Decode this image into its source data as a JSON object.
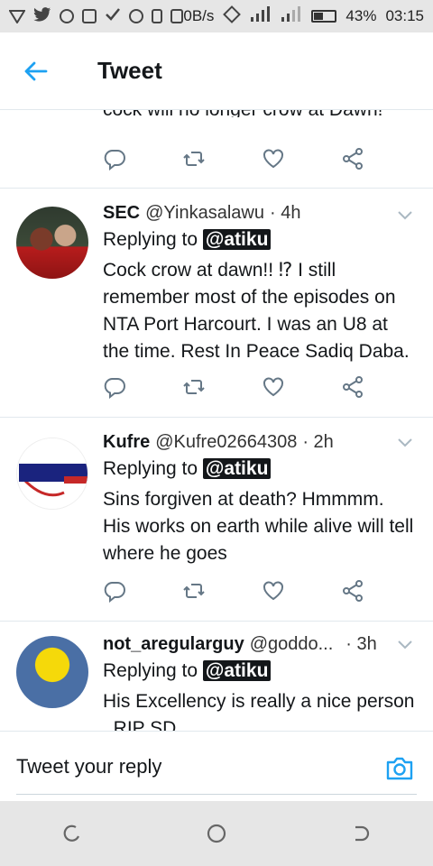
{
  "status_bar": {
    "speed": "0B/s",
    "battery": "43%",
    "time": "03:15"
  },
  "header": {
    "title": "Tweet"
  },
  "previous_tweet": {
    "text_tail": "cock will no longer crow at Dawn!"
  },
  "tweets": [
    {
      "name": "SEC",
      "handle": "@Yinkasalawu",
      "time": "· 4h",
      "replying_prefix": "Replying to",
      "mention": "@atiku",
      "text": "Cock crow at dawn!! ⁉ I still remember most of the episodes on NTA Port Harcourt. I was an U8 at the time. Rest In Peace Sadiq Daba."
    },
    {
      "name": "Kufre",
      "handle": "@Kufre02664308",
      "time": "· 2h",
      "replying_prefix": "Replying to",
      "mention": "@atiku",
      "text": "Sins forgiven at death? Hmmmm. His works on earth while alive will tell where he goes"
    },
    {
      "name": "not_aregularguy",
      "handle": "@goddo...",
      "time": "· 3h",
      "replying_prefix": "Replying to",
      "mention": "@atiku",
      "text": "His Excellency is really a nice person . RIP SD"
    }
  ],
  "reply_bar": {
    "placeholder": "Tweet your reply"
  },
  "colors": {
    "accent": "#1da1f2",
    "icon_gray": "#657786",
    "system_bar": "#e6e6e6"
  }
}
